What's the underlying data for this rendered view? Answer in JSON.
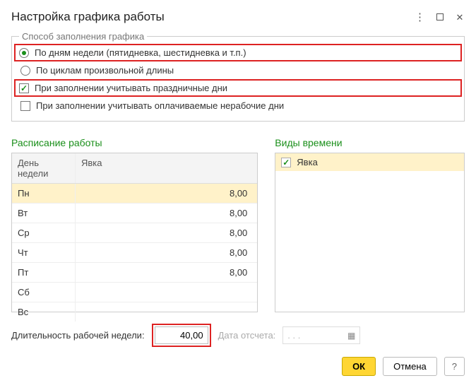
{
  "title": "Настройка графика работы",
  "method_group": {
    "legend": "Способ заполнения графика",
    "by_weekdays": "По дням недели (пятидневка, шестидневка и т.п.)",
    "by_cycles": "По циклам произвольной длины",
    "selected": "by_weekdays"
  },
  "holidays_checkbox": "При заполнении учитывать праздничные дни",
  "paid_nonwork_checkbox": "При заполнении учитывать оплачиваемые нерабочие дни",
  "schedule": {
    "title": "Расписание работы",
    "col_day": "День недели",
    "col_attend": "Явка",
    "rows": [
      {
        "day": "Пн",
        "val": "8,00"
      },
      {
        "day": "Вт",
        "val": "8,00"
      },
      {
        "day": "Ср",
        "val": "8,00"
      },
      {
        "day": "Чт",
        "val": "8,00"
      },
      {
        "day": "Пт",
        "val": "8,00"
      },
      {
        "day": "Сб",
        "val": ""
      },
      {
        "day": "Вс",
        "val": ""
      }
    ]
  },
  "timetypes": {
    "title": "Виды времени",
    "item": "Явка"
  },
  "week_length": {
    "label": "Длительность рабочей недели:",
    "value": "40,00"
  },
  "ref_date": {
    "label": "Дата отсчета:",
    "placeholder": ".   .   ."
  },
  "buttons": {
    "ok": "ОК",
    "cancel": "Отмена",
    "help": "?"
  }
}
